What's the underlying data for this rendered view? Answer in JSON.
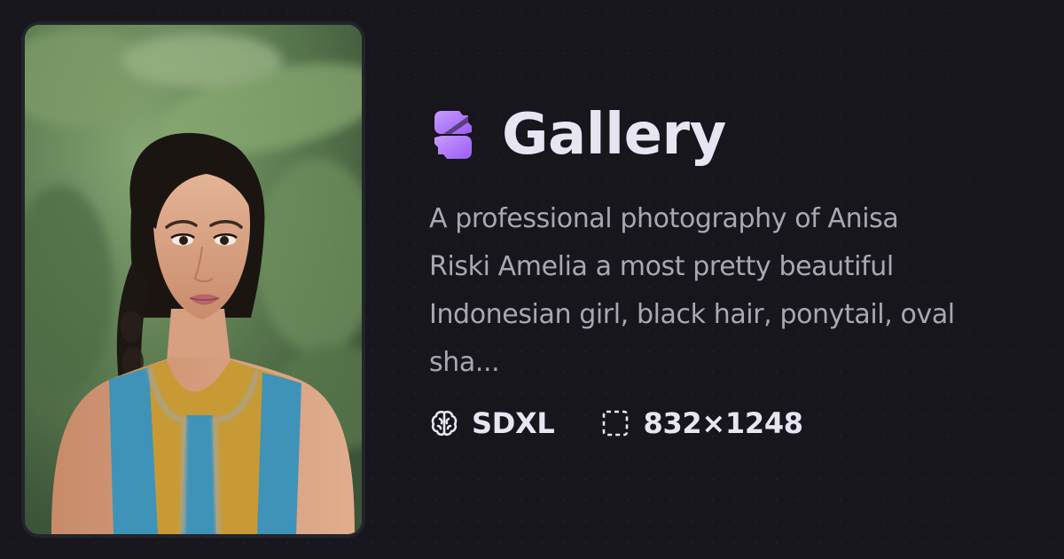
{
  "app": {
    "title": "Gallery",
    "logo_icon": "stable-diffusion-logo-icon",
    "accent_color": "#a96dff"
  },
  "image": {
    "description": "A professional photography of Anisa Riski Amelia a most pretty beautiful Indonesian girl, black hair, ponytail, oval sha...",
    "photo_alt": "Portrait of a young woman with dark hair in a ponytail wearing a mustard and teal sleeveless top, green leafy background"
  },
  "meta": {
    "model": {
      "icon": "brain-icon",
      "label": "SDXL"
    },
    "dimensions": {
      "icon": "dashed-crop-icon",
      "label": "832×1248"
    }
  },
  "colors": {
    "background": "#16161c",
    "title": "#e7e5f1",
    "text": "#a9a7b5",
    "card": "#23232b"
  }
}
